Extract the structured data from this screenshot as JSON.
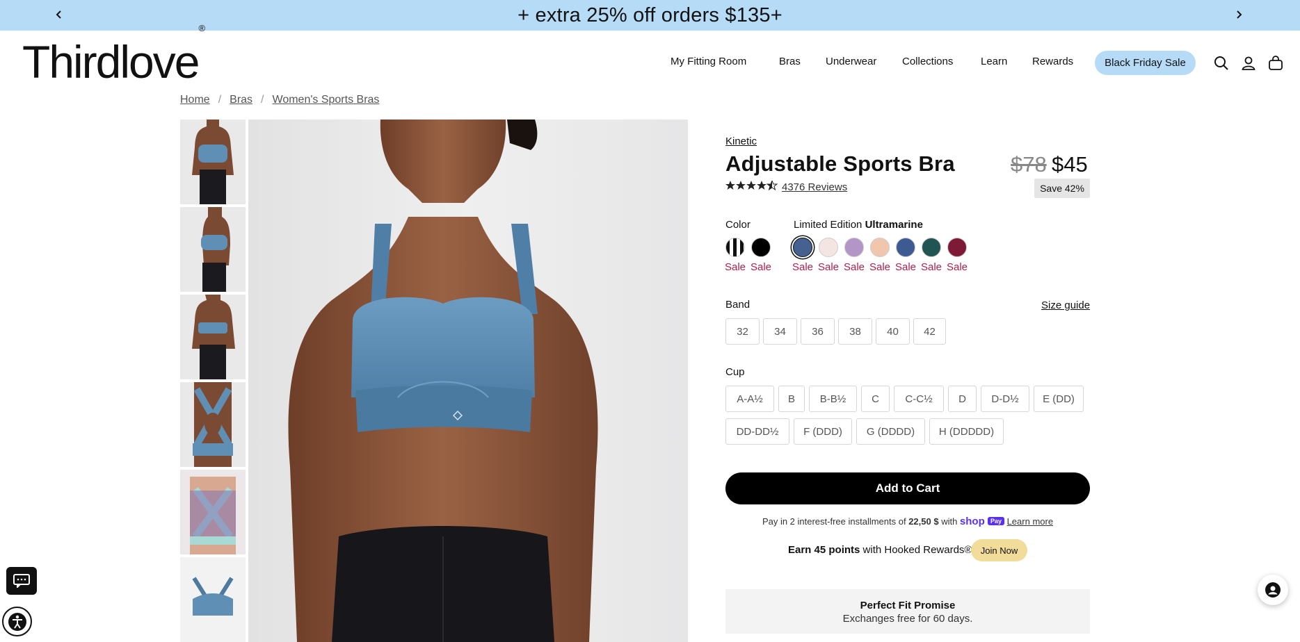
{
  "promo": {
    "text": "+ extra 25% off orders $135+",
    "prev_icon": "chevron-left-icon",
    "next_icon": "chevron-right-icon"
  },
  "header": {
    "logo": "Thirdlove",
    "logo_mark": "®",
    "nav": [
      "My Fitting Room",
      "Bras",
      "Underwear",
      "Collections",
      "Learn",
      "Rewards"
    ],
    "sale_pill": "Black Friday Sale",
    "icons": [
      "search-icon",
      "account-icon",
      "bag-icon"
    ]
  },
  "breadcrumb": {
    "items": [
      "Home",
      "Bras",
      "Women's Sports Bras"
    ],
    "separator": "/"
  },
  "product": {
    "collection": "Kinetic",
    "title": "Adjustable Sports Bra",
    "price_old": "$78",
    "price_new": "$45",
    "save": "Save 42%",
    "rating": 4.5,
    "reviews": "4376 Reviews",
    "color_label": "Color",
    "color_prefix": "Limited Edition ",
    "color_selected": "Ultramarine",
    "sale_label": "Sale",
    "swatches": [
      {
        "color": "#f2f2f2",
        "stripe": true,
        "sale": true
      },
      {
        "color": "#000000",
        "sale": true
      },
      {
        "color": "#44618f",
        "sale": true,
        "selected": true
      },
      {
        "color": "#f3e6e2",
        "sale": true
      },
      {
        "color": "#b395c7",
        "sale": true
      },
      {
        "color": "#f0c6ad",
        "sale": true
      },
      {
        "color": "#3d5a92",
        "sale": true
      },
      {
        "color": "#215553",
        "sale": true
      },
      {
        "color": "#7f1a36",
        "sale": true
      }
    ],
    "band_label": "Band",
    "size_guide": "Size guide",
    "bands": [
      "32",
      "34",
      "36",
      "38",
      "40",
      "42"
    ],
    "cup_label": "Cup",
    "cups": [
      "A-A½",
      "B",
      "B-B½",
      "C",
      "C-C½",
      "D",
      "D-D½",
      "E (DD)",
      "DD-DD½",
      "F (DDD)",
      "G (DDDD)",
      "H (DDDDD)"
    ],
    "add_to_cart": "Add to Cart",
    "installments_pre": "Pay in 2 interest-free installments of ",
    "installments_amount": "22,50 $",
    "installments_with": " with ",
    "shop_logo": "shop",
    "shop_pay": "Pay",
    "learn_more": "Learn more",
    "rewards_earn": "Earn 45 points",
    "rewards_rest": " with Hooked Rewards®",
    "join": "Join Now",
    "promise_title": "Perfect Fit Promise",
    "promise_text": "Exchanges free for 60 days."
  },
  "widgets": {
    "chat": "chat-icon",
    "accessibility": "accessibility-icon",
    "support": "support-agent-icon"
  }
}
